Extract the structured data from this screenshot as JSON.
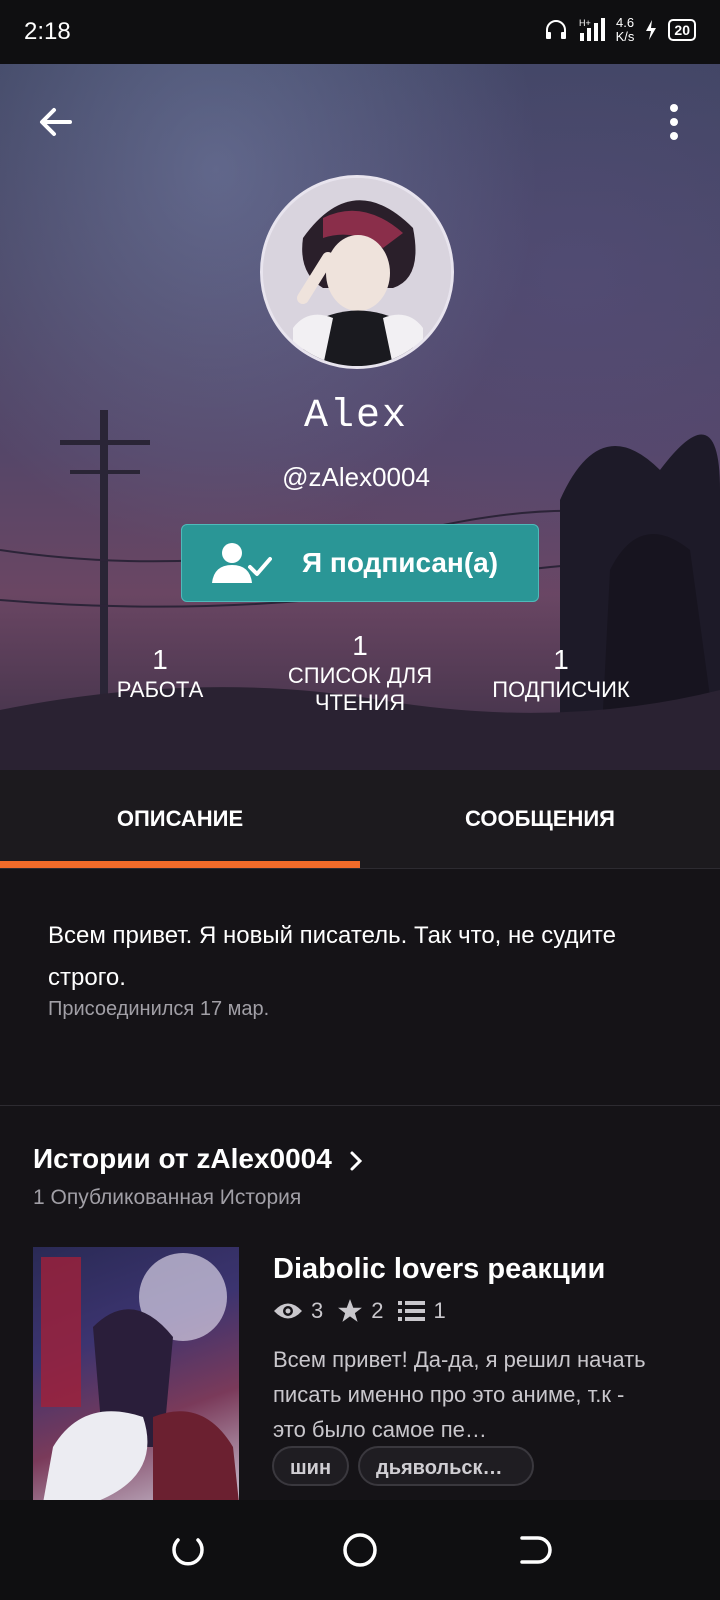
{
  "status_bar": {
    "time": "2:18",
    "speed_value": "4.6",
    "speed_unit": "K/s",
    "battery": "20"
  },
  "profile": {
    "display_name": "Alex",
    "username": "@zAlex0004",
    "follow_button_label": "Я подписан(а)",
    "stats": [
      {
        "value": "1",
        "label": "РАБОТА"
      },
      {
        "value": "1",
        "label": "СПИСОК ДЛЯ ЧТЕНИЯ"
      },
      {
        "value": "1",
        "label": "ПОДПИСЧИК"
      }
    ]
  },
  "tabs": [
    {
      "label": "ОПИСАНИЕ",
      "active": true
    },
    {
      "label": "СООБЩЕНИЯ",
      "active": false
    }
  ],
  "about": {
    "text": "Всем привет. Я новый писатель. Так что, не судите строго.",
    "joined": "Присоединился 17 мар."
  },
  "stories": {
    "title": "Истории от zAlex0004",
    "subtitle": "1 Опубликованная История",
    "items": [
      {
        "title": "Diabolic lovers реакции",
        "reads": "3",
        "votes": "2",
        "parts": "1",
        "description": "Всем привет! Да-да, я решил начать писать именно про это аниме, т.к - это было самое пе…",
        "tags": [
          "шин",
          "дьявольск…"
        ]
      }
    ]
  },
  "colors": {
    "accent": "#f26b2a",
    "follow_button": "#2a9696",
    "background": "#151317"
  },
  "icons": [
    "back-arrow-icon",
    "more-vert-icon",
    "user-check-icon",
    "eye-icon",
    "star-icon",
    "list-icon",
    "chevron-right-icon",
    "headphones-icon",
    "signal-icon",
    "charging-icon"
  ]
}
